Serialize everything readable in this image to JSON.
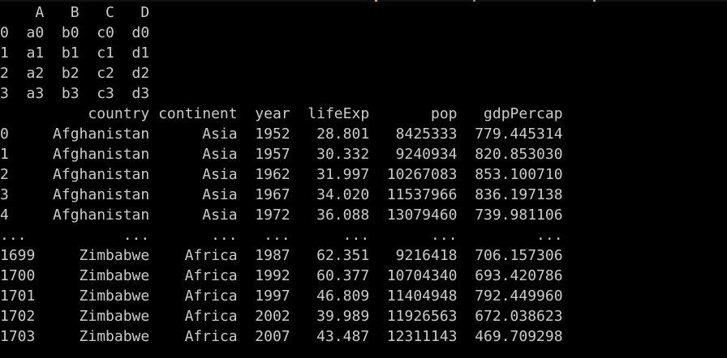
{
  "colors": {
    "background": "#000000",
    "text": "#cccccc",
    "clipped_line_accent": "#c9b15a"
  },
  "terminal": {
    "df1_lines": [
      "    A   B   C   D",
      "0  a0  b0  c0  d0",
      "1  a1  b1  c1  d1",
      "2  a2  b2  c2  d2",
      "3  a3  b3  c3  d3"
    ],
    "df2_lines": [
      "          country continent  year  lifeExp       pop   gdpPercap",
      "0     Afghanistan      Asia  1952   28.801   8425333  779.445314",
      "1     Afghanistan      Asia  1957   30.332   9240934  820.853030",
      "2     Afghanistan      Asia  1962   31.997  10267083  853.100710",
      "3     Afghanistan      Asia  1967   34.020  11537966  836.197138",
      "4     Afghanistan      Asia  1972   36.088  13079460  739.981106",
      "...           ...       ...   ...      ...       ...         ...",
      "1699     Zimbabwe    Africa  1987   62.351   9216418  706.157306",
      "1700     Zimbabwe    Africa  1992   60.377  10704340  693.420786",
      "1701     Zimbabwe    Africa  1997   46.809  11404948  792.449960",
      "1702     Zimbabwe    Africa  2002   39.989  11926563  672.038623",
      "1703     Zimbabwe    Africa  2007   43.487  12311143  469.709298"
    ]
  }
}
